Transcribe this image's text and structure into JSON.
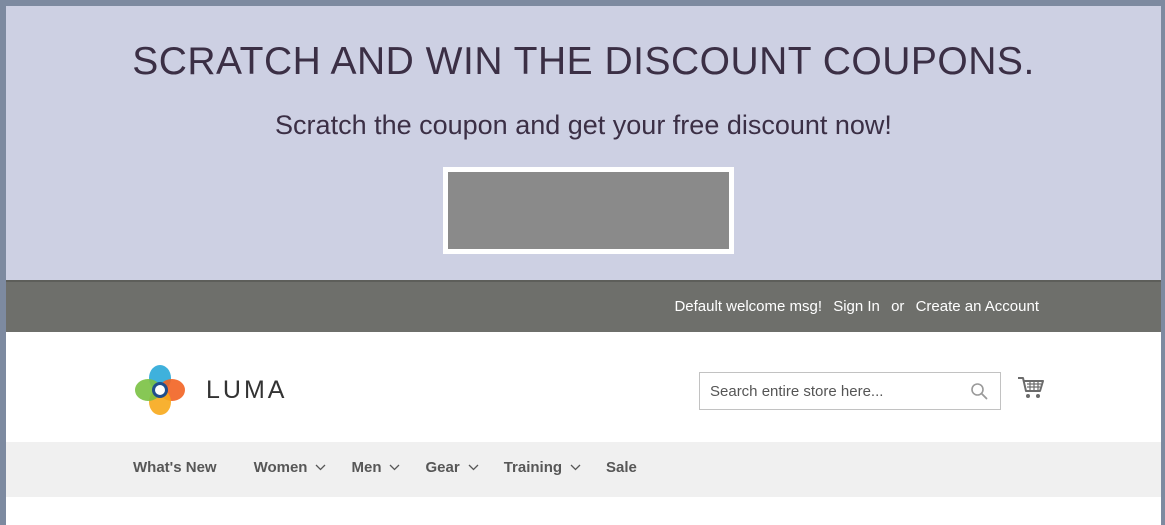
{
  "promo": {
    "title": "SCRATCH AND WIN THE DISCOUNT COUPONS.",
    "subtitle": "Scratch the coupon and get your free discount now!"
  },
  "panel": {
    "welcome": "Default welcome msg!",
    "sign_in": "Sign In",
    "or": "or",
    "create_account": "Create an Account"
  },
  "header": {
    "logo_text": "LUMA",
    "search_placeholder": "Search entire store here..."
  },
  "nav": {
    "items": [
      {
        "label": "What's New",
        "dropdown": false
      },
      {
        "label": "Women",
        "dropdown": true
      },
      {
        "label": "Men",
        "dropdown": true
      },
      {
        "label": "Gear",
        "dropdown": true
      },
      {
        "label": "Training",
        "dropdown": true
      },
      {
        "label": "Sale",
        "dropdown": false
      }
    ]
  },
  "colors": {
    "promo_bg": "#cdd0e3",
    "panel_bg": "#6e6f6b",
    "nav_bg": "#f0f0f0",
    "scratch_surface": "#8a8a8a"
  },
  "icons": [
    "luma-logo-icon",
    "search-icon",
    "cart-icon",
    "chevron-down-icon"
  ]
}
